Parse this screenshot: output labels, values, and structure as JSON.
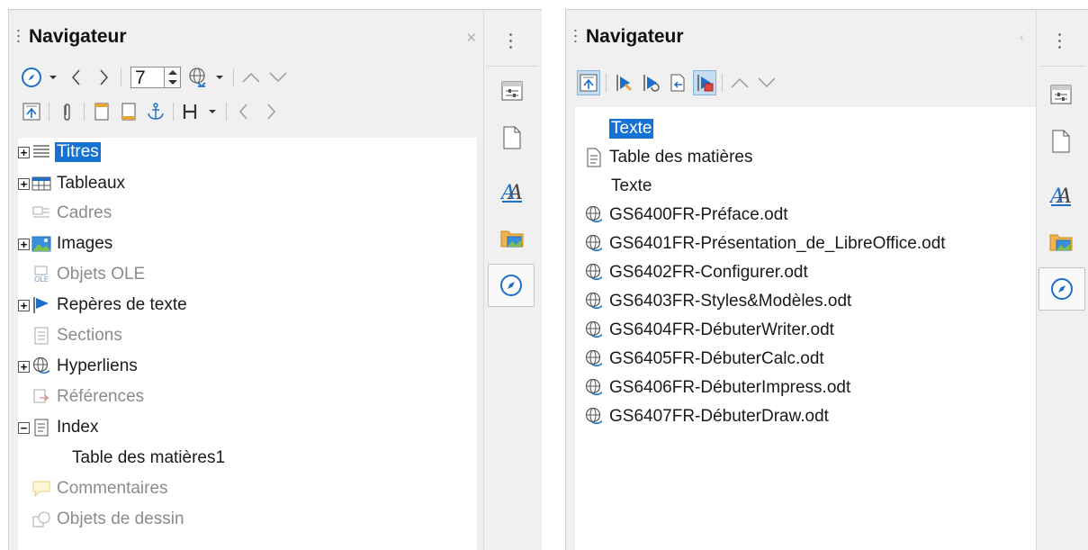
{
  "left_panel": {
    "title": "Navigateur",
    "page_number": "7",
    "tree": [
      {
        "label": "Titres",
        "expandable": true,
        "selected": true,
        "dim": false
      },
      {
        "label": "Tableaux",
        "expandable": true,
        "selected": false,
        "dim": false
      },
      {
        "label": "Cadres",
        "expandable": false,
        "selected": false,
        "dim": true
      },
      {
        "label": "Images",
        "expandable": true,
        "selected": false,
        "dim": false
      },
      {
        "label": "Objets OLE",
        "expandable": false,
        "selected": false,
        "dim": true
      },
      {
        "label": "Repères de texte",
        "expandable": true,
        "selected": false,
        "dim": false
      },
      {
        "label": "Sections",
        "expandable": false,
        "selected": false,
        "dim": true
      },
      {
        "label": "Hyperliens",
        "expandable": true,
        "selected": false,
        "dim": false
      },
      {
        "label": "Références",
        "expandable": false,
        "selected": false,
        "dim": true
      },
      {
        "label": "Index",
        "expandable": true,
        "expanded": true,
        "selected": false,
        "dim": false
      },
      {
        "label": "Table des matières1",
        "child": true,
        "selected": false,
        "dim": false
      },
      {
        "label": "Commentaires",
        "expandable": false,
        "selected": false,
        "dim": true
      },
      {
        "label": "Objets de dessin",
        "expandable": false,
        "selected": false,
        "dim": true
      }
    ]
  },
  "right_panel": {
    "title": "Navigateur",
    "tree": [
      {
        "label": "Texte",
        "icon": "none",
        "selected": true
      },
      {
        "label": "Table des matières",
        "icon": "document-icon",
        "selected": false
      },
      {
        "label": "Texte",
        "icon": "none",
        "selected": false
      },
      {
        "label": "GS6400FR-Préface.odt",
        "icon": "globe-link-icon",
        "selected": false
      },
      {
        "label": "GS6401FR-Présentation_de_LibreOffice.odt",
        "icon": "globe-link-icon",
        "selected": false
      },
      {
        "label": "GS6402FR-Configurer.odt",
        "icon": "globe-link-icon",
        "selected": false
      },
      {
        "label": "GS6403FR-Styles&Modèles.odt",
        "icon": "globe-link-icon",
        "selected": false
      },
      {
        "label": "GS6404FR-DébuterWriter.odt",
        "icon": "globe-link-icon",
        "selected": false
      },
      {
        "label": "GS6405FR-DébuterCalc.odt",
        "icon": "globe-link-icon",
        "selected": false
      },
      {
        "label": "GS6406FR-DébuterImpress.odt",
        "icon": "globe-link-icon",
        "selected": false
      },
      {
        "label": "GS6407FR-DébuterDraw.odt",
        "icon": "globe-link-icon",
        "selected": false
      }
    ]
  },
  "colors": {
    "selection": "#1673d4",
    "accent_blue": "#1c6ec9",
    "panel_bg": "#f0f0f0",
    "dim_text": "#8c8c8c"
  }
}
